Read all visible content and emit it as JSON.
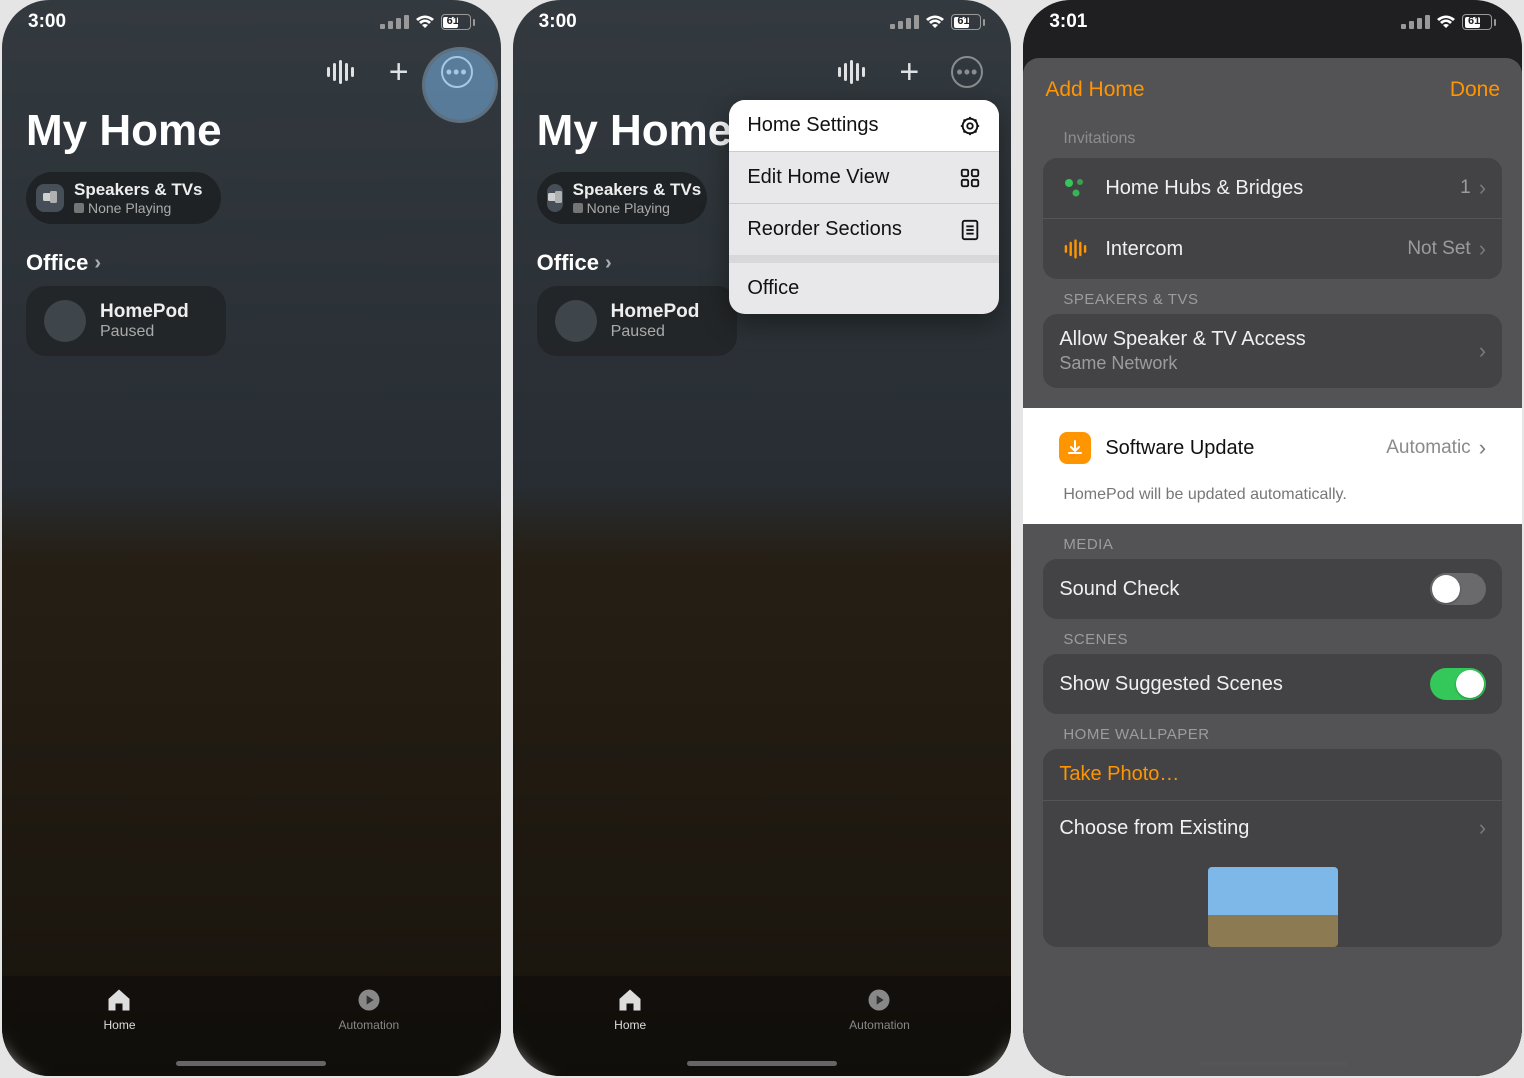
{
  "status": {
    "time1": "3:00",
    "time2": "3:00",
    "time3": "3:01",
    "battery": "61"
  },
  "home": {
    "title": "My Home",
    "chip": {
      "title": "Speakers & TVs",
      "subtitle": "None Playing"
    },
    "section": "Office",
    "device": {
      "name": "HomePod",
      "status": "Paused"
    }
  },
  "tabs": {
    "home": "Home",
    "automation": "Automation"
  },
  "menu": {
    "home_settings": "Home Settings",
    "edit_view": "Edit Home View",
    "reorder": "Reorder Sections",
    "office": "Office"
  },
  "settings": {
    "add_home": "Add Home",
    "done": "Done",
    "invitations": "Invitations",
    "hubs": {
      "label": "Home Hubs & Bridges",
      "value": "1"
    },
    "intercom": {
      "label": "Intercom",
      "value": "Not Set"
    },
    "speakers_head": "SPEAKERS & TVS",
    "access": {
      "label": "Allow Speaker & TV Access",
      "sub": "Same Network"
    },
    "software": {
      "label": "Software Update",
      "value": "Automatic",
      "note": "HomePod will be updated automatically."
    },
    "media_head": "MEDIA",
    "sound_check": "Sound Check",
    "scenes_head": "SCENES",
    "suggested": "Show Suggested Scenes",
    "wallpaper_head": "HOME WALLPAPER",
    "take_photo": "Take Photo…",
    "choose_existing": "Choose from Existing"
  }
}
